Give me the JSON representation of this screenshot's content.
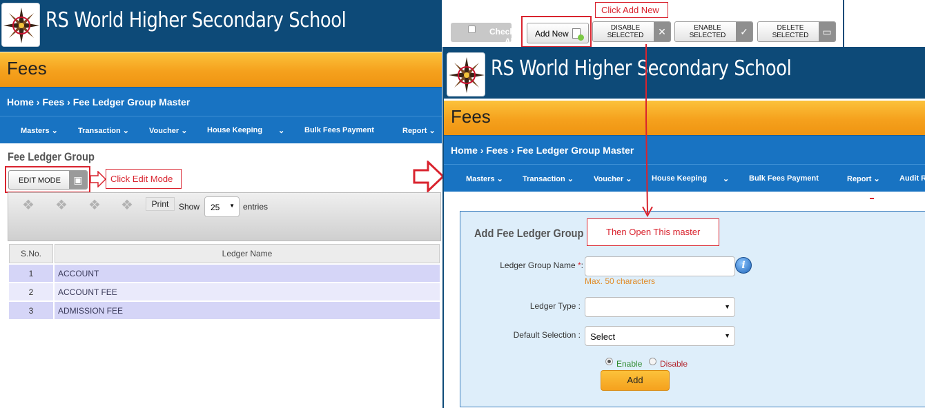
{
  "school_name": "RS World Higher Secondary School",
  "module_title": "Fees",
  "breadcrumb": "Home › Fees › Fee Ledger Group Master",
  "menu": {
    "masters": "Masters ⌄",
    "transaction": "Transaction ⌄",
    "voucher": "Voucher ⌄",
    "house_keeping": "House Keeping",
    "house_keeping_arrow": "⌄",
    "bulk_fees": "Bulk Fees Payment",
    "report": "Report ⌄",
    "audit": "Audit R"
  },
  "left": {
    "page_title": "Fee Ledger Group",
    "edit_mode_label": "EDIT MODE",
    "print_label": "Print",
    "show_label": "Show",
    "entries_value": "25",
    "entries_label": "entries",
    "table": {
      "headers": [
        "S.No.",
        "Ledger Name"
      ],
      "rows": [
        [
          "1",
          "ACCOUNT"
        ],
        [
          "2",
          "ACCOUNT FEE"
        ],
        [
          "3",
          "ADMISSION FEE"
        ]
      ]
    }
  },
  "annotations": {
    "click_edit_mode": "Click Edit Mode",
    "click_add_new": "Click Add New",
    "then_open": "Then Open This master"
  },
  "top_toolbar": {
    "check_all_1": "Check",
    "check_all_2": "All",
    "add_new": "Add New",
    "disable_1": "DISABLE",
    "disable_2": "SELECTED",
    "enable_1": "ENABLE",
    "enable_2": "SELECTED",
    "delete_1": "DELETE",
    "delete_2": "SELECTED"
  },
  "form": {
    "title": "Add Fee Ledger Group",
    "ledger_group_name_label": "Ledger Group Name",
    "required_mark": "*",
    "colon": ":",
    "max_hint": "Max. 50 characters",
    "ledger_type_label": "Ledger Type :",
    "ledger_type_value": "",
    "default_selection_label": "Default Selection :",
    "default_selection_value": "Select",
    "enable_label": "Enable",
    "disable_label": "Disable",
    "add_button": "Add"
  },
  "colors": {
    "header_blue": "#0d4a78",
    "nav_blue": "#1873c2",
    "band_orange": "#f5a11d",
    "annotation_red": "#d9232e",
    "form_bg": "#deeefa"
  },
  "icons": {
    "logo": "compass-star-logo",
    "puzzle": "puzzle-icon",
    "edit": "basket-icon",
    "add_new": "document-add-icon",
    "disable": "x-icon",
    "enable": "check-icon",
    "delete": "trash-icon",
    "info": "info-icon"
  }
}
